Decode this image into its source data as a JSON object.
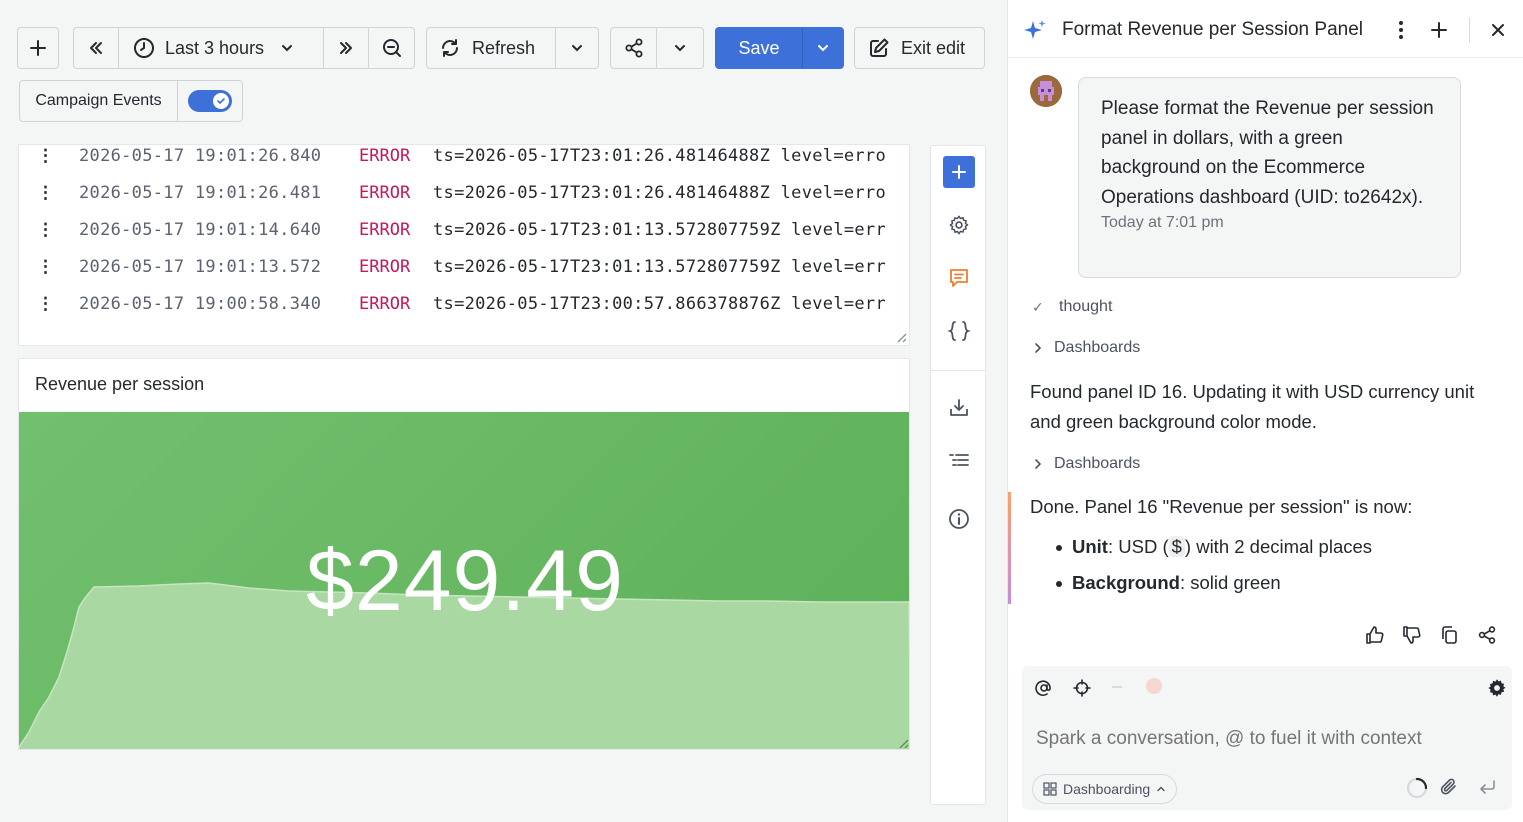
{
  "toolbar": {
    "time_range": "Last 3 hours",
    "refresh_label": "Refresh",
    "save_label": "Save",
    "exit_edit_label": "Exit edit",
    "variable_label": "Campaign Events"
  },
  "logs": [
    {
      "time": "2026-05-17 19:01:26.840",
      "level": "ERROR",
      "message": "ts=2026-05-17T23:01:26.48146488Z level=erro"
    },
    {
      "time": "2026-05-17 19:01:26.481",
      "level": "ERROR",
      "message": "ts=2026-05-17T23:01:26.48146488Z level=erro"
    },
    {
      "time": "2026-05-17 19:01:14.640",
      "level": "ERROR",
      "message": "ts=2026-05-17T23:01:13.572807759Z level=err"
    },
    {
      "time": "2026-05-17 19:01:13.572",
      "level": "ERROR",
      "message": "ts=2026-05-17T23:01:13.572807759Z level=err"
    },
    {
      "time": "2026-05-17 19:00:58.340",
      "level": "ERROR",
      "message": "ts=2026-05-17T23:00:57.866378876Z level=err"
    }
  ],
  "panel": {
    "title": "Revenue per session",
    "value": "$249.49",
    "background_color": "#5fb35b"
  },
  "assistant": {
    "title": "Format Revenue per Session Panel",
    "user_message": "Please format the Revenue per session panel in dollars, with a green background on the Ecommerce Operations dashboard (UID: to2642x).",
    "user_time": "Today at 7:01 pm",
    "step_thought": "thought",
    "step_dashboards_1": "Dashboards",
    "found_text": "Found panel ID 16. Updating it with USD currency unit and green background color mode.",
    "step_dashboards_2": "Dashboards",
    "done_text": "Done. Panel 16 \"Revenue per session\" is now:",
    "bullet_unit_label": "Unit",
    "bullet_unit_pre": ": USD (",
    "bullet_unit_code": "$",
    "bullet_unit_post": ") with 2 decimal places",
    "bullet_bg_label": "Background",
    "bullet_bg_text": ": solid green",
    "composer_placeholder": "Spark a conversation, @ to fuel it with context",
    "mode_chip": "Dashboarding"
  },
  "colors": {
    "primary": "#3d71d9",
    "error": "#c4175c",
    "stat_green": "#5fb35b",
    "comment_orange": "#ef7d2c"
  }
}
